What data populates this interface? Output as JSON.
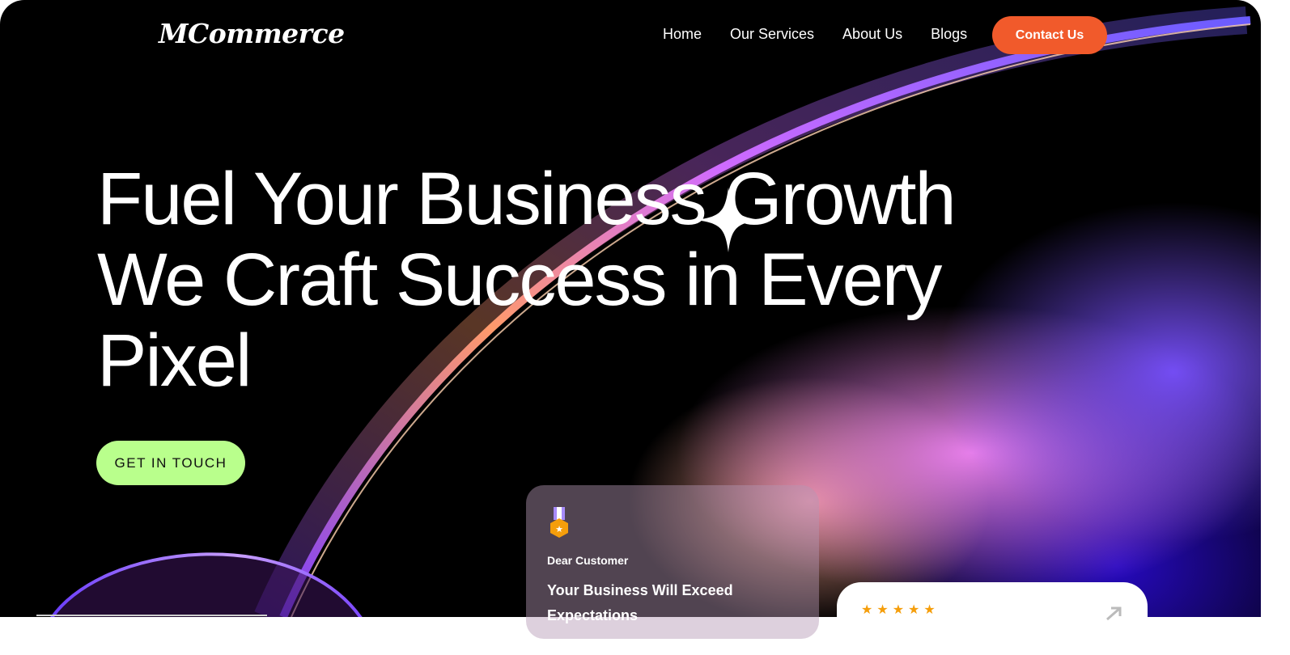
{
  "brand": {
    "logo_text": "MCommerce"
  },
  "nav": {
    "items": [
      {
        "label": "Home"
      },
      {
        "label": "Our Services"
      },
      {
        "label": "About Us"
      },
      {
        "label": "Blogs"
      }
    ],
    "contact_label": "Contact Us"
  },
  "hero": {
    "headline_line1": "Fuel Your Business Growth",
    "headline_line2": "We Craft Success in Every",
    "headline_line3": "Pixel",
    "cta_label": "GET IN TOUCH"
  },
  "card": {
    "eyebrow": "Dear Customer",
    "title": "Your Business Will Exceed Expectations"
  },
  "review": {
    "stars": "★★★★★"
  },
  "colors": {
    "accent_orange": "#f15a2b",
    "cta_green": "#b9ff8c",
    "background": "#000000"
  },
  "icons": [
    "sparkle-icon",
    "medal-icon",
    "star-icon",
    "arrow-up-right-icon"
  ]
}
